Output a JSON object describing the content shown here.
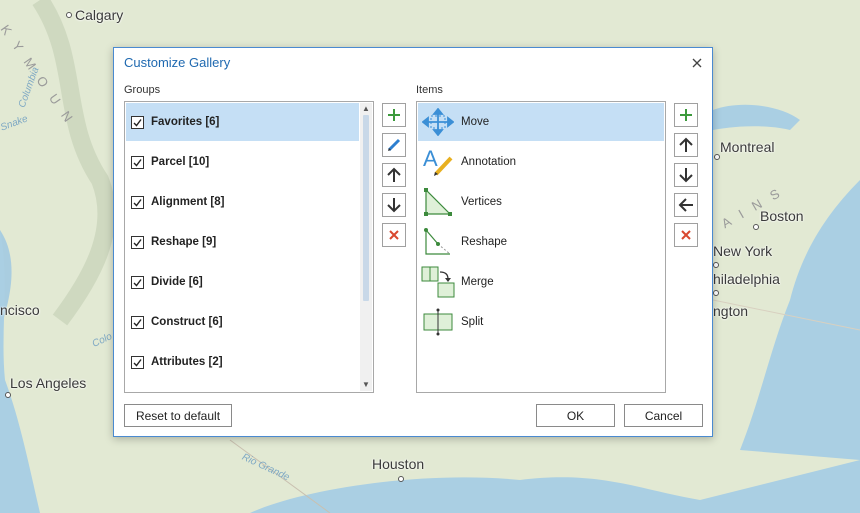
{
  "map": {
    "cities": [
      "Calgary",
      "Montreal",
      "Boston",
      "New York",
      "Philadelphia",
      "Washington",
      "San Francisco",
      "Los Angeles",
      "Houston"
    ],
    "cities_visible": [
      "Calgary",
      "Montreal",
      "Boston",
      "New York",
      "hiladelphia",
      "ngton",
      "ncisco",
      "Los Angeles",
      "Houston"
    ],
    "water": [
      "Columbia",
      "Snake",
      "Colo",
      "Rio Grande"
    ],
    "mountains_left": "K Y   M O U N",
    "mountains_right": "A I N S"
  },
  "dialog": {
    "title": "Customize Gallery",
    "groups_label": "Groups",
    "items_label": "Items",
    "groups": [
      {
        "label": "Favorites [6]",
        "checked": true,
        "selected": true
      },
      {
        "label": "Parcel [10]",
        "checked": true,
        "selected": false
      },
      {
        "label": "Alignment [8]",
        "checked": true,
        "selected": false
      },
      {
        "label": "Reshape [9]",
        "checked": true,
        "selected": false
      },
      {
        "label": "Divide [6]",
        "checked": true,
        "selected": false
      },
      {
        "label": "Construct [6]",
        "checked": true,
        "selected": false
      },
      {
        "label": "Attributes [2]",
        "checked": true,
        "selected": false
      }
    ],
    "items": [
      {
        "label": "Move",
        "icon": "move-icon",
        "selected": true
      },
      {
        "label": "Annotation",
        "icon": "annotation-icon",
        "selected": false
      },
      {
        "label": "Vertices",
        "icon": "vertices-icon",
        "selected": false
      },
      {
        "label": "Reshape",
        "icon": "reshape-icon",
        "selected": false
      },
      {
        "label": "Merge",
        "icon": "merge-icon",
        "selected": false
      },
      {
        "label": "Split",
        "icon": "split-icon",
        "selected": false
      }
    ],
    "buttons": {
      "reset": "Reset to default",
      "ok": "OK",
      "cancel": "Cancel"
    },
    "colors": {
      "accent": "#1f69b0",
      "selection": "#c5dff5",
      "add_green": "#3c9a3c",
      "delete_red": "#d9482f"
    }
  }
}
